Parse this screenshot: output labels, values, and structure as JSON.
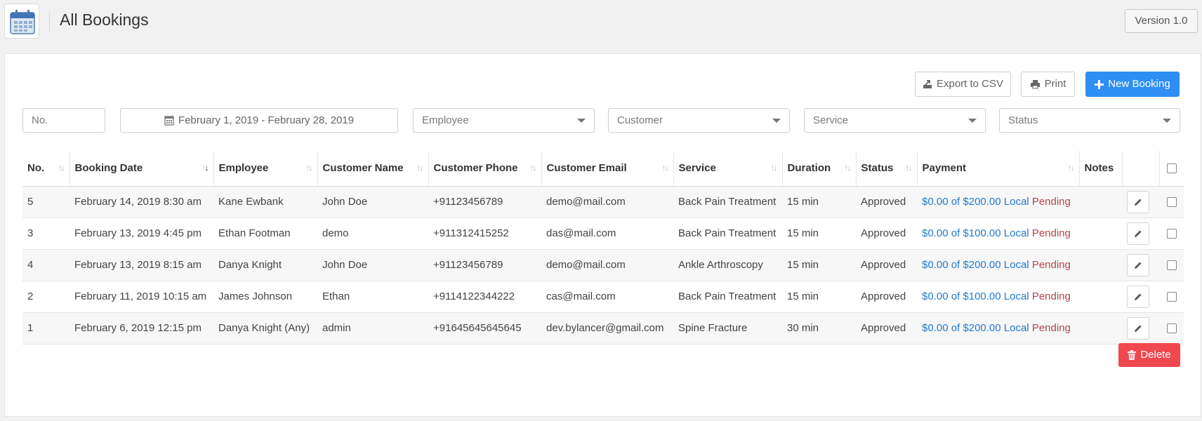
{
  "header": {
    "title": "All Bookings",
    "version_label": "Version 1.0"
  },
  "toolbar": {
    "export_label": "Export to CSV",
    "print_label": "Print",
    "new_booking_label": "New Booking",
    "delete_label": "Delete"
  },
  "filters": {
    "number_placeholder": "No.",
    "date_range": "February 1, 2019 - February 28, 2019",
    "employee_placeholder": "Employee",
    "customer_placeholder": "Customer",
    "service_placeholder": "Service",
    "status_placeholder": "Status"
  },
  "table": {
    "columns": [
      "No.",
      "Booking Date",
      "Employee",
      "Customer Name",
      "Customer Phone",
      "Customer Email",
      "Service",
      "Duration",
      "Status",
      "Payment",
      "Notes"
    ],
    "rows": [
      {
        "no": "5",
        "date": "February 14, 2019 8:30 am",
        "employee": "Kane Ewbank",
        "customer": "John Doe",
        "phone": "+91123456789",
        "email": "demo@mail.com",
        "service": "Back Pain Treatment",
        "duration": "15 min",
        "status": "Approved",
        "payment_amount": "$0.00 of $200.00",
        "payment_method": "Local",
        "payment_status": "Pending",
        "notes": ""
      },
      {
        "no": "3",
        "date": "February 13, 2019 4:45 pm",
        "employee": "Ethan Footman",
        "customer": "demo",
        "phone": "+911312415252",
        "email": "das@mail.com",
        "service": "Back Pain Treatment",
        "duration": "15 min",
        "status": "Approved",
        "payment_amount": "$0.00 of $100.00",
        "payment_method": "Local",
        "payment_status": "Pending",
        "notes": ""
      },
      {
        "no": "4",
        "date": "February 13, 2019 8:15 am",
        "employee": "Danya Knight",
        "customer": "John Doe",
        "phone": "+91123456789",
        "email": "demo@mail.com",
        "service": "Ankle Arthroscopy",
        "duration": "15 min",
        "status": "Approved",
        "payment_amount": "$0.00 of $200.00",
        "payment_method": "Local",
        "payment_status": "Pending",
        "notes": ""
      },
      {
        "no": "2",
        "date": "February 11, 2019 10:15 am",
        "employee": "James Johnson",
        "customer": "Ethan",
        "phone": "+9114122344222",
        "email": "cas@mail.com",
        "service": "Back Pain Treatment",
        "duration": "15 min",
        "status": "Approved",
        "payment_amount": "$0.00 of $100.00",
        "payment_method": "Local",
        "payment_status": "Pending",
        "notes": ""
      },
      {
        "no": "1",
        "date": "February 6, 2019 12:15 pm",
        "employee": "Danya Knight (Any)",
        "customer": "admin",
        "phone": "+91645645645645",
        "email": "dev.bylancer@gmail.com",
        "service": "Spine Fracture",
        "duration": "30 min",
        "status": "Approved",
        "payment_amount": "$0.00 of $200.00",
        "payment_method": "Local",
        "payment_status": "Pending",
        "notes": ""
      }
    ]
  },
  "icons": {
    "app": "calendar-icon",
    "export": "export-icon",
    "print": "printer-icon",
    "new": "plus-icon",
    "date": "calendar-icon",
    "edit": "pencil-icon",
    "delete": "trash-icon",
    "sort": "sort-icon"
  },
  "colors": {
    "primary": "#2e8ef3",
    "danger": "#f1474f",
    "payment_link": "#1f7bd1",
    "pending": "#b0454b"
  }
}
